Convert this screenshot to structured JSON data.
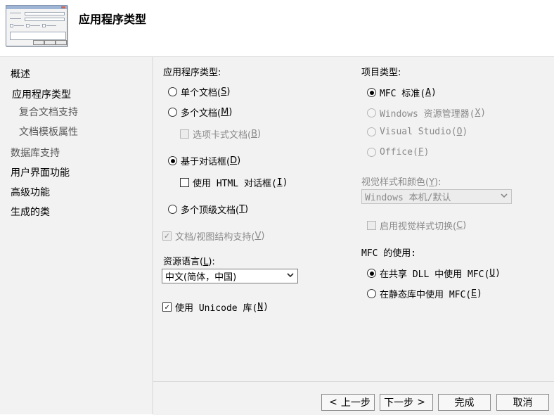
{
  "header": {
    "title": "应用程序类型"
  },
  "sidebar": {
    "items": [
      {
        "label": "概述"
      },
      {
        "label": "应用程序类型"
      },
      {
        "label": "复合文档支持"
      },
      {
        "label": "文档模板属性"
      },
      {
        "label": "数据库支持"
      },
      {
        "label": "用户界面功能"
      },
      {
        "label": "高级功能"
      },
      {
        "label": "生成的类"
      }
    ]
  },
  "app_type": {
    "label": "应用程序类型:",
    "single": {
      "text": "单个文档(",
      "key": "S",
      "tail": ")",
      "checked": false
    },
    "multi": {
      "text": "多个文档(",
      "key": "M",
      "tail": ")",
      "checked": false
    },
    "tabbed": {
      "text": "选项卡式文档(",
      "key": "B",
      "tail": ")",
      "checked": false,
      "enabled": false
    },
    "dialog": {
      "text": "基于对话框(",
      "key": "D",
      "tail": ")",
      "checked": true
    },
    "html_dialog": {
      "text": "使用 HTML 对话框(",
      "key": "I",
      "tail": ")",
      "checked": false
    },
    "multi_top": {
      "text": "多个顶级文档(",
      "key": "T",
      "tail": ")",
      "checked": false
    },
    "doc_view": {
      "text": "文档/视图结构支持(",
      "key": "V",
      "tail": ")",
      "checked": true,
      "enabled": false
    }
  },
  "resource_lang": {
    "label_text": "资源语言(",
    "label_key": "L",
    "label_tail": "):",
    "value": "中文(简体，中国)"
  },
  "unicode": {
    "text": "使用 Unicode 库(",
    "key": "N",
    "tail": ")",
    "checked": true
  },
  "project_type": {
    "label": "项目类型:",
    "mfc_standard": {
      "text": "MFC 标准(",
      "key": "A",
      "tail": ")",
      "checked": true
    },
    "explorer": {
      "text": "Windows 资源管理器(",
      "key": "X",
      "tail": ")",
      "enabled": false
    },
    "visual_studio": {
      "text": "Visual Studio(",
      "key": "O",
      "tail": ")",
      "enabled": false
    },
    "office": {
      "text": "Office(",
      "key": "F",
      "tail": ")",
      "enabled": false
    }
  },
  "visual_style": {
    "label_text": "视觉样式和颜色(",
    "label_key": "Y",
    "label_tail": "):",
    "value": "Windows 本机/默认",
    "enabled": false
  },
  "switching": {
    "text": "启用视觉样式切换(",
    "key": "C",
    "tail": ")",
    "checked": false,
    "enabled": false
  },
  "mfc_use": {
    "label": "MFC 的使用:",
    "shared": {
      "text": "在共享 DLL 中使用 MFC(",
      "key": "U",
      "tail": ")",
      "checked": true
    },
    "static": {
      "text": "在静态库中使用 MFC(",
      "key": "E",
      "tail": ")",
      "checked": false
    }
  },
  "footer": {
    "prev": "上一步",
    "next": "下一步",
    "finish": "完成",
    "cancel": "取消"
  },
  "icons": {
    "prev": "chevron-left-icon",
    "next": "chevron-right-icon",
    "dropdown": "chevron-down-icon"
  },
  "colors": {
    "panel_bg": "#f2f2f2",
    "disabled_text": "#8a8a8a"
  }
}
